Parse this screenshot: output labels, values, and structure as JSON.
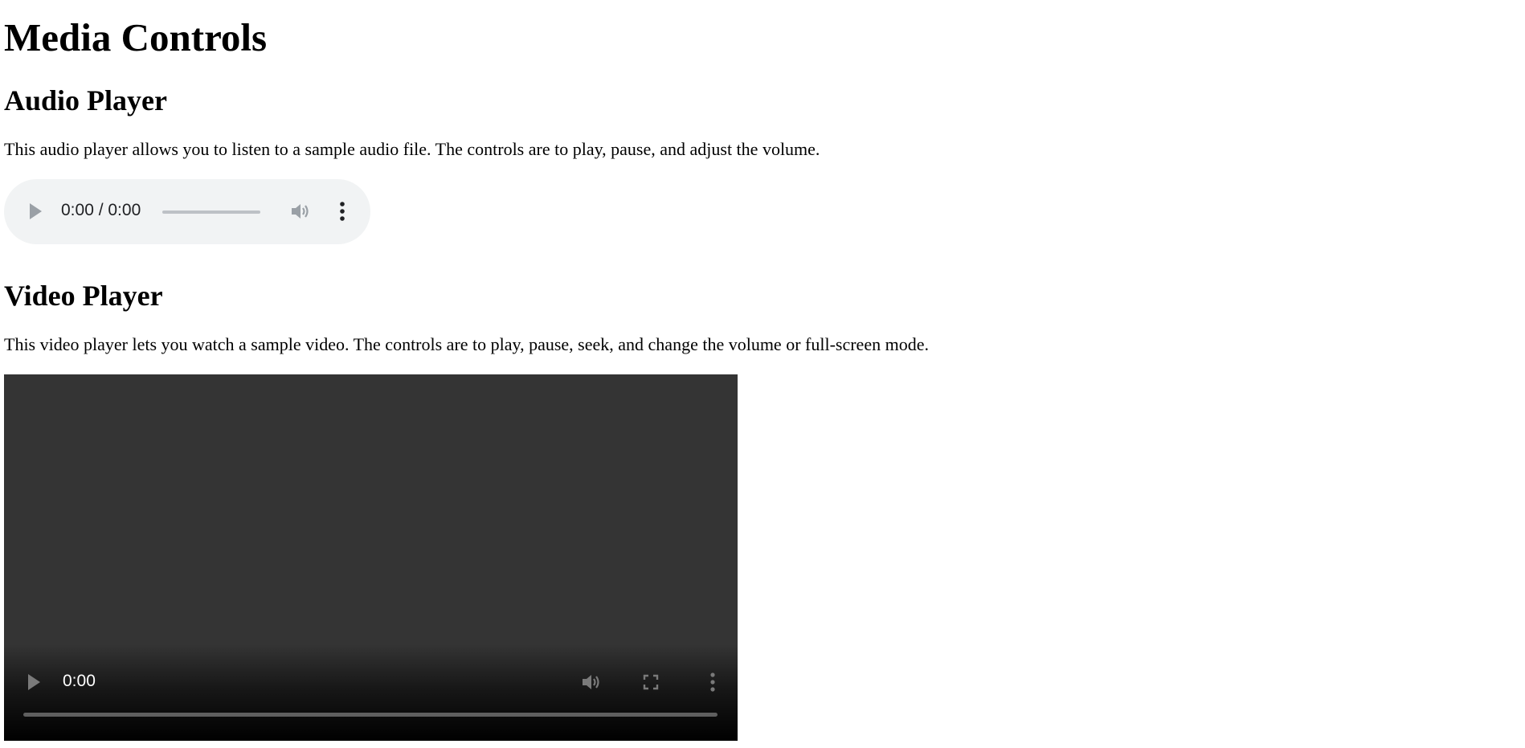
{
  "page": {
    "title": "Media Controls"
  },
  "audio_section": {
    "heading": "Audio Player",
    "description": "This audio player allows you to listen to a sample audio file. The controls are to play, pause, and adjust the volume.",
    "player": {
      "time_display": "0:00 / 0:00",
      "progress": 0,
      "play_icon": "play-icon",
      "volume_icon": "volume-icon",
      "more_icon": "more-vert-icon",
      "background_color": "#f1f3f4"
    }
  },
  "video_section": {
    "heading": "Video Player",
    "description": "This video player lets you watch a sample video. The controls are to play, pause, seek, and change the volume or full-screen mode.",
    "player": {
      "time_display": "0:00",
      "progress": 0,
      "play_icon": "play-icon",
      "volume_icon": "volume-icon",
      "fullscreen_icon": "fullscreen-icon",
      "more_icon": "more-vert-icon",
      "background_color": "#343434"
    }
  }
}
